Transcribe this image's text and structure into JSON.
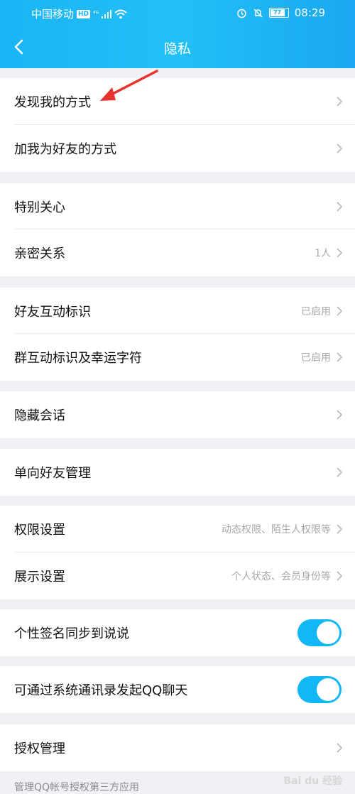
{
  "status_bar": {
    "carrier": "中国移动",
    "network_badge": "HD",
    "signal": "⁴ᴳ",
    "battery": "77",
    "time": "08:29"
  },
  "nav": {
    "title": "隐私"
  },
  "rows": {
    "discover": {
      "label": "发现我的方式"
    },
    "add_friend": {
      "label": "加我为好友的方式"
    },
    "special_care": {
      "label": "特别关心"
    },
    "intimate": {
      "label": "亲密关系",
      "value": "1人"
    },
    "friend_badge": {
      "label": "好友互动标识",
      "value": "已启用"
    },
    "group_badge": {
      "label": "群互动标识及幸运字符",
      "value": "已启用"
    },
    "hidden_chat": {
      "label": "隐藏会话"
    },
    "oneway": {
      "label": "单向好友管理"
    },
    "permission": {
      "label": "权限设置",
      "value": "动态权限、陌生人权限等"
    },
    "display": {
      "label": "展示设置",
      "value": "个人状态、会员身份等"
    },
    "signature_sync": {
      "label": "个性签名同步到说说",
      "on": true
    },
    "contacts_chat": {
      "label": "可通过系统通讯录发起QQ聊天",
      "on": true
    },
    "auth": {
      "label": "授权管理"
    }
  },
  "footnote": "管理QQ帐号授权第三方应用",
  "watermark": "Bai du 经验",
  "colors": {
    "header": "#1ab4f6",
    "toggle_on": "#12b7f5",
    "annotation_arrow": "#e8322d"
  }
}
